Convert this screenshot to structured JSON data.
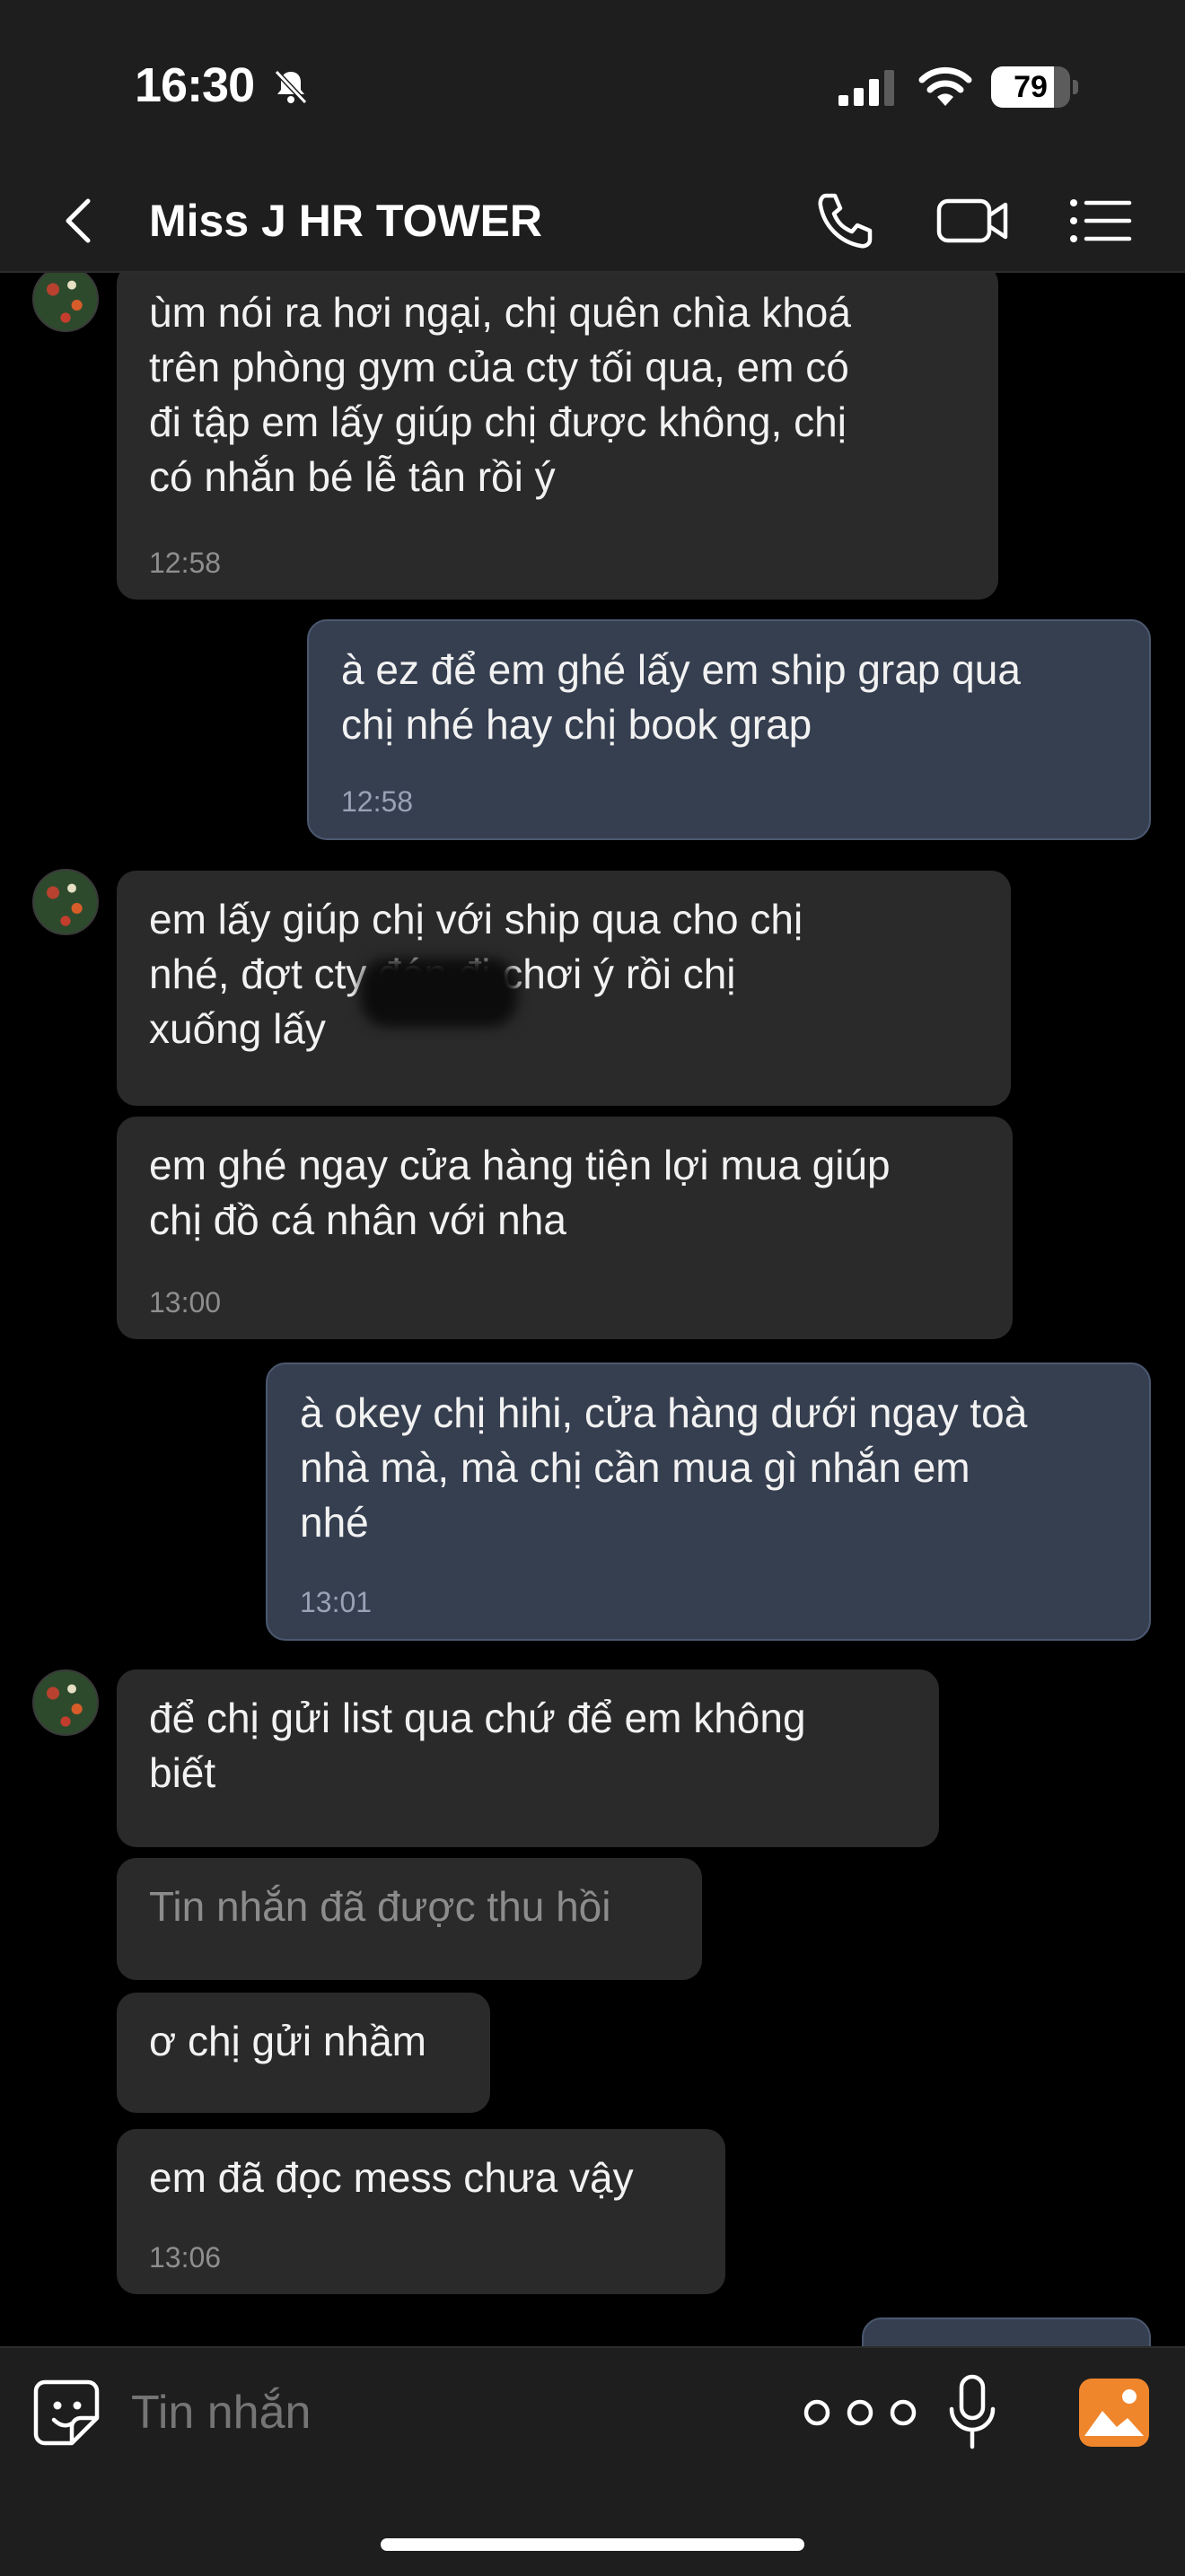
{
  "status_bar": {
    "time": "16:30",
    "battery_percent": "79",
    "battery_level": 0.79,
    "icons": [
      "bell-slash-icon",
      "cellular-signal-icon",
      "wifi-icon",
      "battery-icon"
    ]
  },
  "header": {
    "title": "Miss J HR TOWER",
    "icons": [
      "chevron-left-icon",
      "phone-icon",
      "video-camera-icon",
      "list-menu-icon"
    ]
  },
  "messages": [
    {
      "side": "received",
      "text": "ùm nói ra hơi ngại, chị quên chìa khoá\ntrên phòng gym của cty tối qua, em có\nđi tập em lấy giúp chị được không, chị\ncó nhắn bé lễ tân rồi ý",
      "time": "12:58"
    },
    {
      "side": "sent",
      "text": "à ez để em ghé lấy em ship grap qua\nchị nhé hay chị book grap",
      "time": "12:58"
    },
    {
      "side": "received",
      "text": "em lấy giúp chị với ship qua cho chị\nnhé,             đợt cty đón đi chơi ý rồi chị\nxuống lấy",
      "time": ""
    },
    {
      "side": "received",
      "text": "em ghé ngay cửa hàng tiện lợi mua giúp\nchị đồ cá nhân với nha",
      "time": "13:00"
    },
    {
      "side": "sent",
      "text": "à okey chị hihi, cửa hàng dưới ngay toà\nnhà mà, mà chị cần mua gì nhắn em\nnhé",
      "time": "13:01"
    },
    {
      "side": "received",
      "text": "để chị gửi list qua chứ để em không\nbiết",
      "time": ""
    },
    {
      "side": "received",
      "text": "Tin nhắn đã được thu hồi",
      "time": "",
      "recalled": true
    },
    {
      "side": "received",
      "text": "ơ chị gửi nhầm",
      "time": ""
    },
    {
      "side": "received",
      "text": "em đã đọc mess chưa vậy",
      "time": "13:06"
    }
  ],
  "composer": {
    "placeholder": "Tin nhắn",
    "icons": [
      "sticker-smile-icon",
      "more-dots-icon",
      "microphone-icon",
      "image-icon"
    ],
    "image_button_color": "#f0862c"
  },
  "colors": {
    "background": "#000000",
    "bar": "#1e1e1e",
    "received_bubble": "#2a2a2a",
    "sent_bubble": "#363f50"
  }
}
